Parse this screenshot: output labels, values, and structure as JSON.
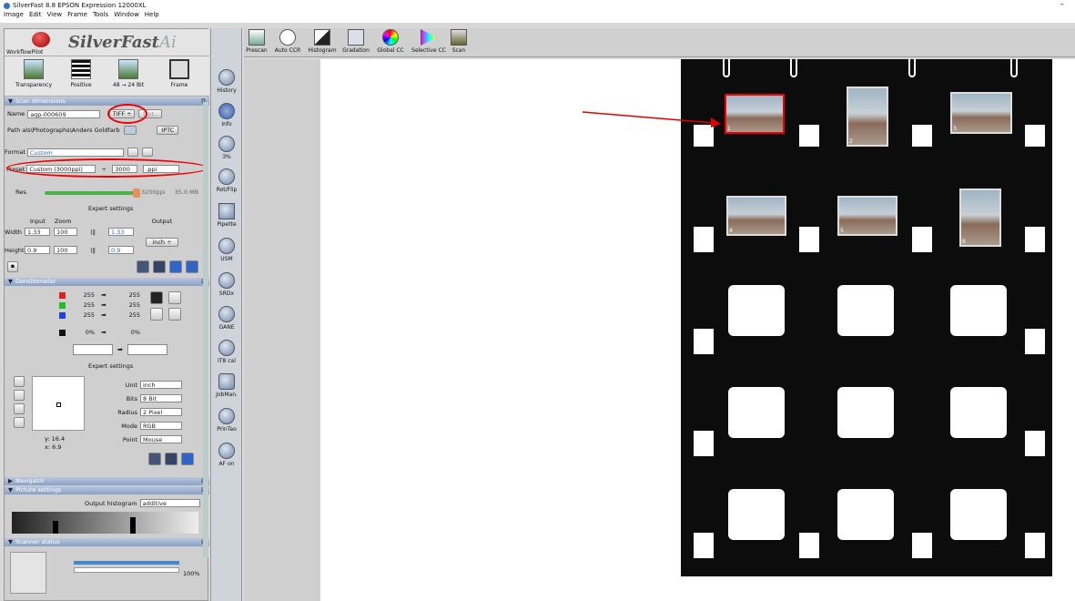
{
  "window": {
    "title": "SilverFast 8.8 EPSON Expression 12000XL",
    "minimize": "–"
  },
  "menu": [
    "Image",
    "Edit",
    "View",
    "Frame",
    "Tools",
    "Window",
    "Help"
  ],
  "logo": {
    "workflow": "WorkflowPilot",
    "brand": "SilverFast",
    "ai": "Ai"
  },
  "modes": [
    {
      "label": "Transparency",
      "icon": "transparency-icon"
    },
    {
      "label": "Positive",
      "icon": "film-strip-icon"
    },
    {
      "label": "48 → 24 Bit",
      "icon": "bitdepth-icon"
    },
    {
      "label": "Frame",
      "icon": "frame-icon"
    }
  ],
  "scan": {
    "section": "Scan dimensions",
    "name_label": "Name",
    "name_value": "agp-000609",
    "filetype": "TIFF ÷",
    "opt": "Opt..",
    "path_label": "Path",
    "path_value": "als\\Photographs\\Anders Goldfarb",
    "iptc": "IPTC",
    "format_label": "Format",
    "format_value": "Custom",
    "preset_label": "Preset",
    "preset_value": "Custom (3000ppi)",
    "preset_arrow": "÷",
    "ppi_value": "3000",
    "ppi_unit": ".ppi",
    "res_label": "Res.",
    "res_value": "3200ppi",
    "size": "35.0 MB",
    "expert": "Expert settings",
    "input": "Input",
    "zoom": "Zoom",
    "output": "Output",
    "width_label": "Width",
    "width_in": "1.33",
    "width_zoom": "100",
    "width_out": "1.33",
    "height_label": "Height",
    "height_in": "0.9",
    "height_zoom": "100",
    "height_out": "0.9",
    "unit": "inch ÷"
  },
  "densitometer": {
    "section": "Densitometer",
    "rows": [
      {
        "ch": "R",
        "in": "255",
        "out": "255",
        "color": "#e02020"
      },
      {
        "ch": "G",
        "in": "255",
        "out": "255",
        "color": "#20c020"
      },
      {
        "ch": "B",
        "in": "255",
        "out": "255",
        "color": "#2040e0"
      },
      {
        "ch": "K",
        "in": "0%",
        "out": "0%",
        "color": "#111111"
      }
    ],
    "expert": "Expert settings",
    "unit_label": "Unit",
    "unit_value": "inch",
    "bits_label": "Bits",
    "bits_value": "8 Bit",
    "radius_label": "Radius",
    "radius_value": "2 Pixel",
    "mode_label": "Mode",
    "mode_value": "RGB",
    "point_label": "Point",
    "point_value": "Mouse",
    "y": "y: 16.4",
    "x": "x: 6.9"
  },
  "navigator": "Navigator",
  "picture": {
    "section": "Picture settings",
    "hist_label": "Output histogram",
    "hist_value": "additive"
  },
  "scanner": {
    "section": "Scanner status",
    "percent": "100%"
  },
  "tools": [
    {
      "label": "History",
      "icon": "history-icon"
    },
    {
      "label": "Info",
      "icon": "info-icon"
    },
    {
      "label": "3%",
      "icon": "zoom-icon"
    },
    {
      "label": "Rot/Flip",
      "icon": "rotate-icon"
    },
    {
      "label": "Pipette",
      "icon": "pipette-icon"
    },
    {
      "label": "USM",
      "icon": "usm-icon"
    },
    {
      "label": "SRDx",
      "icon": "srdx-icon"
    },
    {
      "label": "GANE",
      "icon": "gane-icon"
    },
    {
      "label": "IT8 cal",
      "icon": "it8-icon"
    },
    {
      "label": "JobMan.",
      "icon": "jobmanager-icon"
    },
    {
      "label": "PrinTao",
      "icon": "printao-icon"
    },
    {
      "label": "AF on",
      "icon": "autofocus-icon"
    }
  ],
  "toolbar": [
    {
      "label": "Prescan",
      "icon": "prescan-icon"
    },
    {
      "label": "Auto CCR",
      "icon": "auto-ccr-icon"
    },
    {
      "label": "Histogram",
      "icon": "histogram-icon"
    },
    {
      "label": "Gradation",
      "icon": "gradation-icon"
    },
    {
      "label": "Global CC",
      "icon": "global-cc-icon"
    },
    {
      "label": "Selective CC",
      "icon": "selective-cc-icon"
    },
    {
      "label": "Scan",
      "icon": "scan-icon"
    }
  ],
  "frames": [
    "1",
    "2",
    "3",
    "4",
    "5",
    "6"
  ],
  "colors": {
    "highlight": "#e00000",
    "accent": "#2f64c8"
  }
}
